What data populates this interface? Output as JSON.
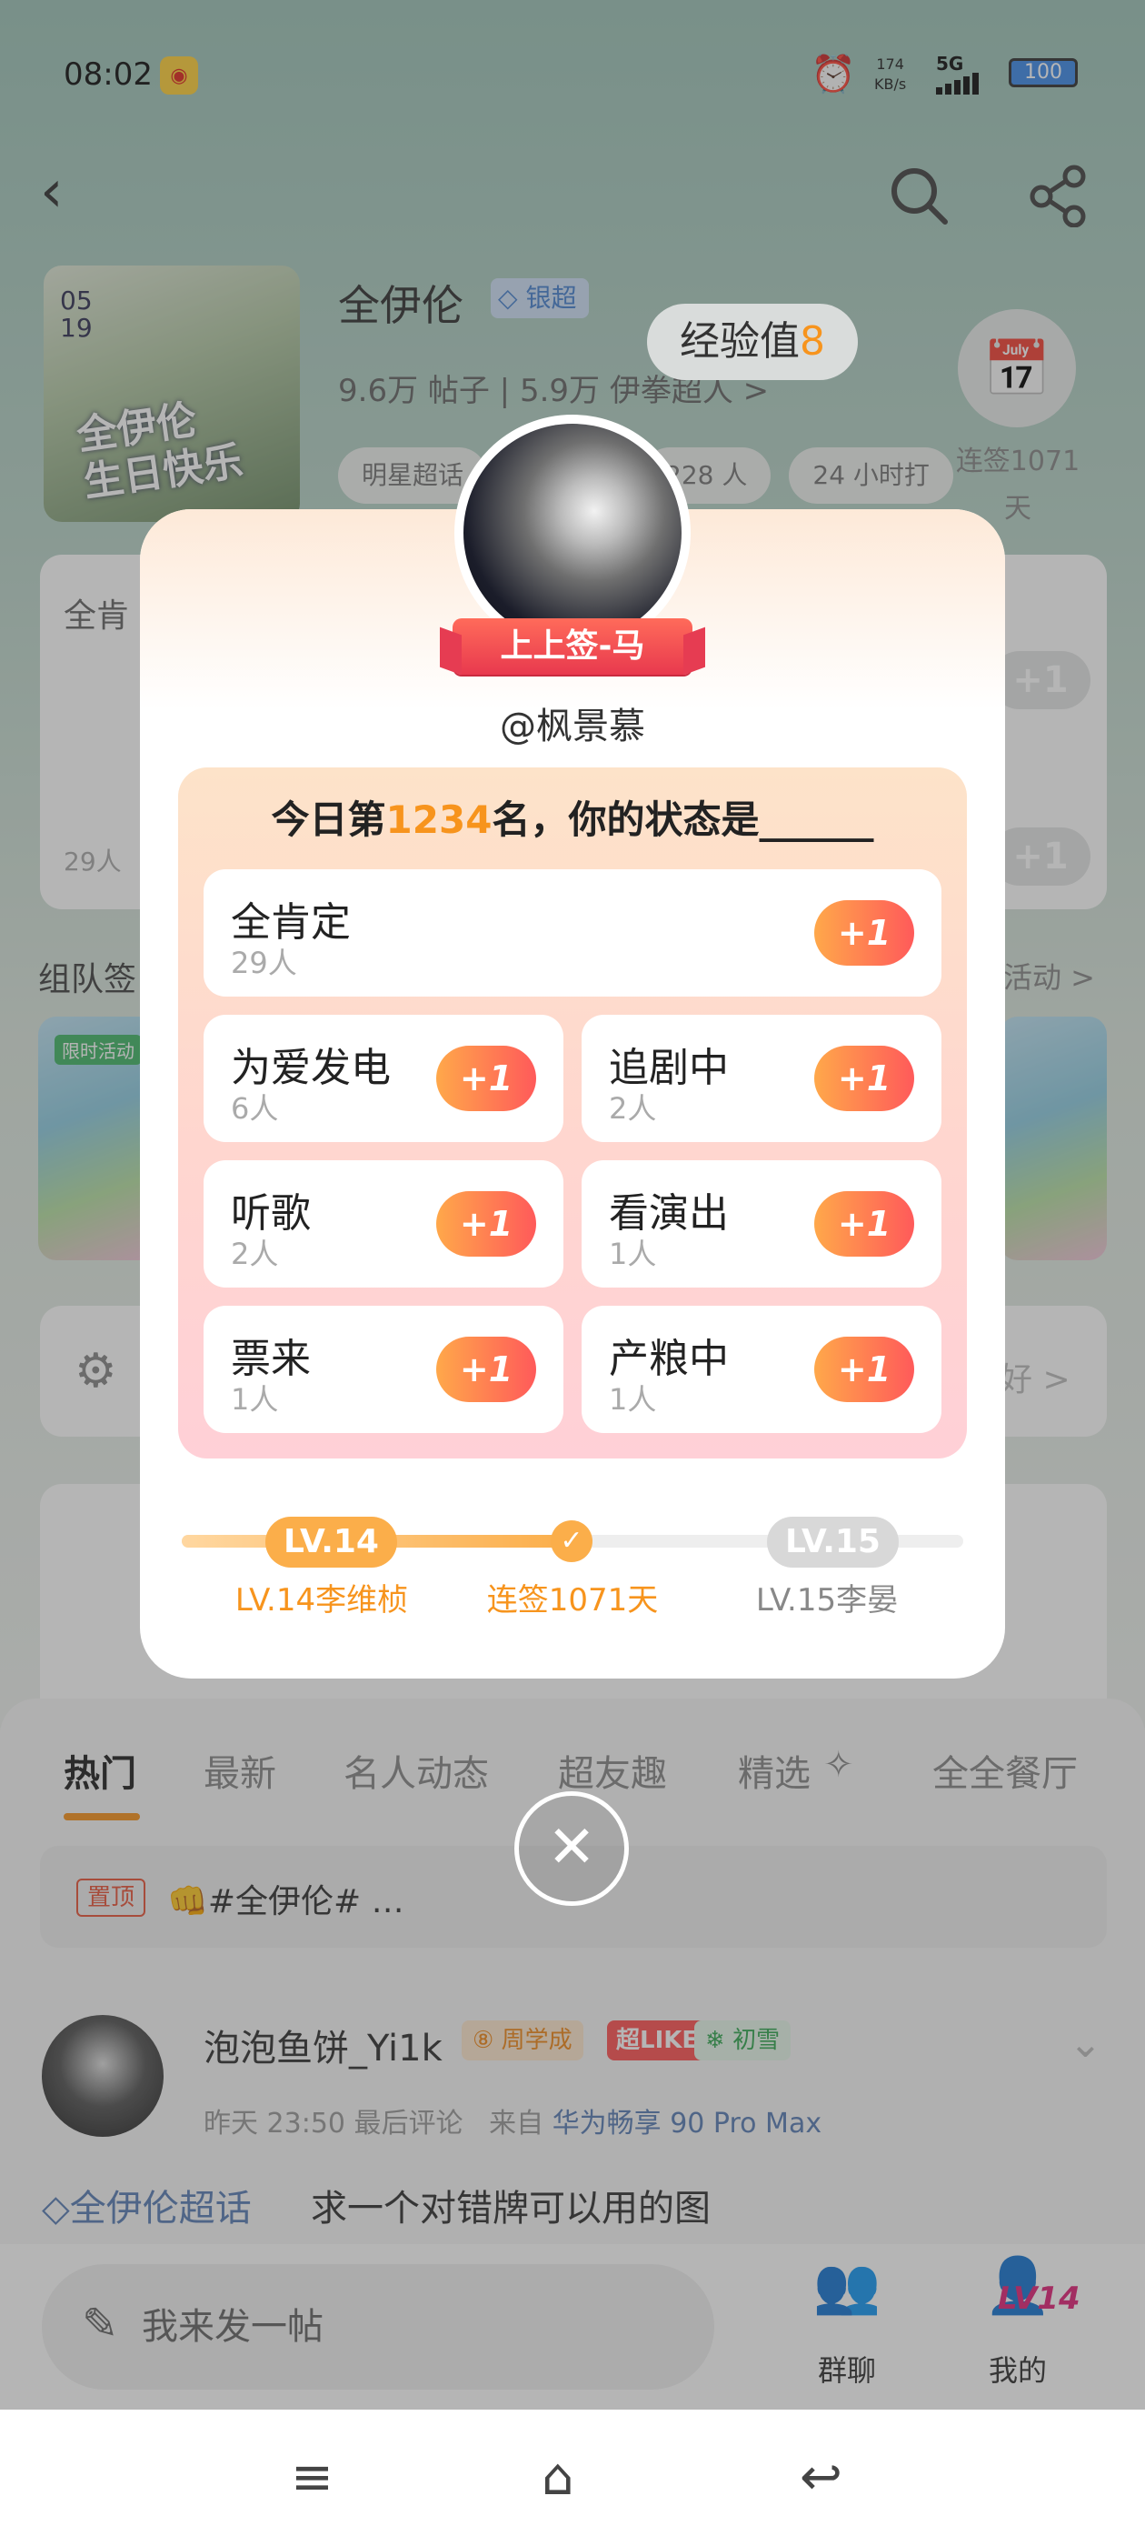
{
  "status_bar": {
    "time": "08:02",
    "net_speed_value": "174",
    "net_speed_unit": "KB/s",
    "signal": "5G",
    "battery": "100"
  },
  "nav": {
    "back_icon": "chevron-left-icon",
    "search_icon": "search-icon",
    "share_icon": "share-icon"
  },
  "topic": {
    "cover_date": "05\n19",
    "cover_caption": "全伊伦\n生日快乐",
    "name": "全伊伦",
    "level_badge": "银超",
    "stats": "9.6万 帖子 | 5.9万 伊拳超人 >",
    "chips": [
      "明星超话",
      "228 人",
      "24 小时打"
    ],
    "streak": "连签1071天"
  },
  "exp_bubble": {
    "label": "经验值",
    "value": "8"
  },
  "background_cards": {
    "card1_title": "全肯",
    "card1_count": "29人",
    "team_title": "组队签",
    "team_more": "活动 >",
    "limited_tag": "限时活动",
    "settings_text": "好 >"
  },
  "modal": {
    "ribbon": "上上签-马",
    "username": "@枫景慕",
    "question_prefix": "今日第",
    "rank": "1234",
    "question_suffix": "名，你的状态是______",
    "plus_label": "+1",
    "options": [
      {
        "label": "全肯定",
        "count": "29人"
      },
      {
        "label": "为爱发电",
        "count": "6人"
      },
      {
        "label": "追剧中",
        "count": "2人"
      },
      {
        "label": "听歌",
        "count": "2人"
      },
      {
        "label": "看演出",
        "count": "1人"
      },
      {
        "label": "票来",
        "count": "1人"
      },
      {
        "label": "产粮中",
        "count": "1人"
      }
    ],
    "progress": {
      "current_level": "LV.14",
      "next_level": "LV.15",
      "current_label": "LV.14李维桢",
      "middle_label": "连签1071天",
      "next_label": "LV.15李晏",
      "fill_fraction": 0.5
    },
    "close_icon": "close-icon"
  },
  "feed": {
    "tabs": [
      "热门",
      "最新",
      "名人动态",
      "超友趣",
      "精选",
      "全全餐厅"
    ],
    "active_tab": 0,
    "pinned_tag": "置顶",
    "pinned_text": "👊#全伊伦# …",
    "post": {
      "author": "泡泡鱼饼_Yi1k",
      "badge_week": "周学成",
      "badge_like": "超LIKE",
      "badge_green": "初雪",
      "time": "昨天 23:50 最后评论",
      "from_prefix": "来自",
      "device": "华为畅享 90 Pro Max",
      "topic": "全伊伦超话",
      "text": "求一个对错牌可以用的图"
    }
  },
  "bottom_bar": {
    "compose_placeholder": "我来发一帖",
    "group_chat": "群聊",
    "mine": "我的",
    "mine_badge": "LV14"
  },
  "system_nav": {
    "menu_icon": "menu-icon",
    "home_icon": "home-icon",
    "back_icon": "back-icon"
  },
  "colors": {
    "accent": "#f7941d",
    "plus_gradient_start": "#ffa84a",
    "plus_gradient_end": "#ff5a5a",
    "ribbon": "#e8394e",
    "link_blue": "#5b7fb5"
  }
}
